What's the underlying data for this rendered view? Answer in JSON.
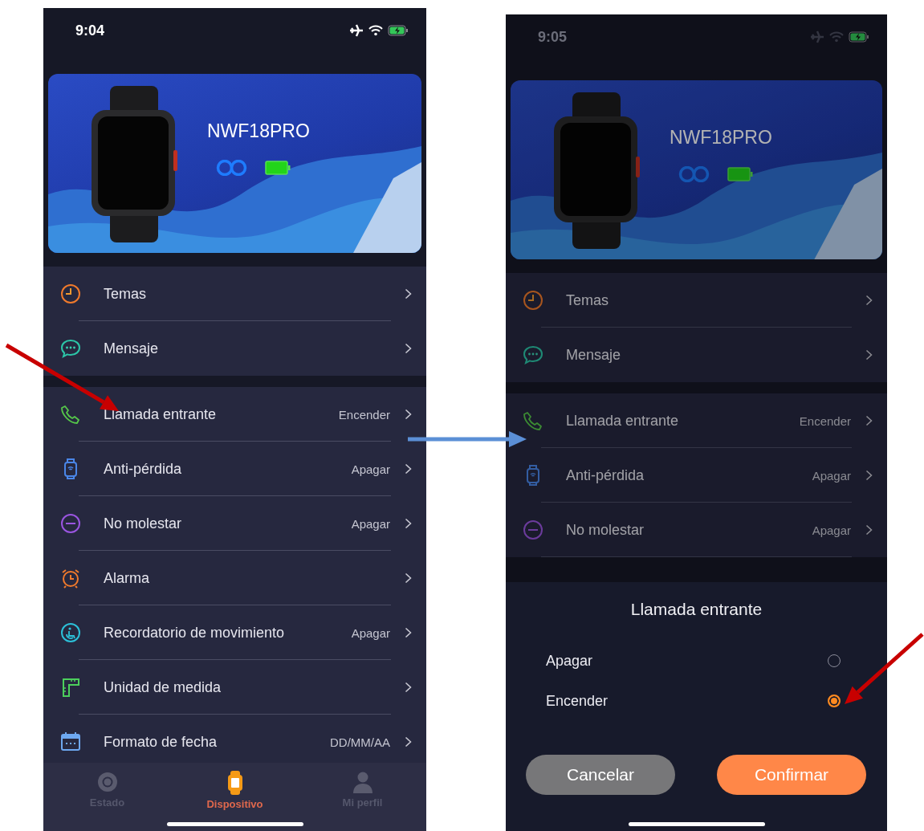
{
  "screens": [
    {
      "status_bar": {
        "time": "9:04",
        "dark_text": false
      },
      "device": {
        "name": "NWF18PRO"
      },
      "dimmed": false,
      "menu_groups": [
        [
          {
            "label": "Temas"
          },
          {
            "label": "Mensaje"
          }
        ],
        [
          {
            "label": "Llamada entrante",
            "value": "Encender"
          },
          {
            "label": "Anti-pérdida",
            "value": "Apagar"
          },
          {
            "label": "No molestar",
            "value": "Apagar"
          },
          {
            "label": "Alarma"
          },
          {
            "label": "Recordatorio de movimiento",
            "value": "Apagar"
          },
          {
            "label": "Unidad de medida"
          },
          {
            "label": "Formato de fecha",
            "value": "DD/MM/AA"
          }
        ]
      ],
      "tab_bar": [
        {
          "label": "Estado",
          "selected": false
        },
        {
          "label": "Dispositivo",
          "selected": true
        },
        {
          "label": "Mi perfil",
          "selected": false
        }
      ]
    },
    {
      "status_bar": {
        "time": "9:05",
        "dark_text": true
      },
      "device": {
        "name": "NWF18PRO"
      },
      "dimmed": true,
      "menu_groups": [
        [
          {
            "label": "Temas"
          },
          {
            "label": "Mensaje"
          }
        ],
        [
          {
            "label": "Llamada entrante",
            "value": "Encender"
          },
          {
            "label": "Anti-pérdida",
            "value": "Apagar"
          },
          {
            "label": "No molestar",
            "value": "Apagar"
          }
        ]
      ],
      "sheet": {
        "title": "Llamada entrante",
        "options": [
          {
            "label": "Apagar",
            "selected": false
          },
          {
            "label": "Encender",
            "selected": true
          }
        ],
        "buttons": [
          {
            "label": "Cancelar",
            "kind": "secondary"
          },
          {
            "label": "Confirmar",
            "kind": "primary"
          }
        ]
      }
    }
  ],
  "arrows": [
    {
      "color": "#c80000"
    },
    {
      "color": "#5b8fd6"
    },
    {
      "color": "#c80000"
    }
  ]
}
